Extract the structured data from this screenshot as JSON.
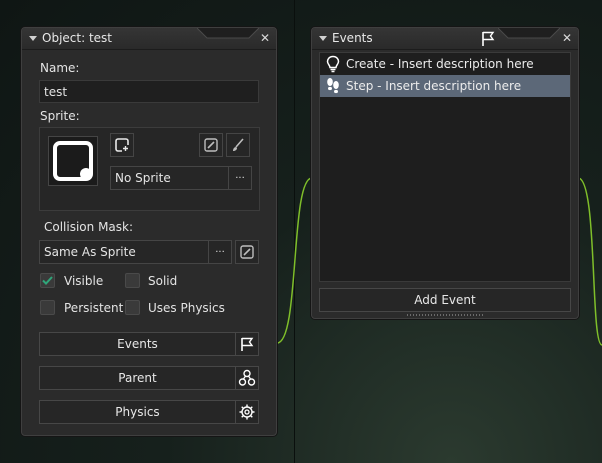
{
  "object_panel": {
    "title": "Object: test",
    "close_glyph": "✕",
    "name_label": "Name:",
    "name_value": "test",
    "sprite_label": "Sprite:",
    "sprite_value": "No Sprite",
    "sprite_menu_glyph": "···",
    "collision_label": "Collision Mask:",
    "collision_value": "Same As Sprite",
    "collision_menu_glyph": "···",
    "checkboxes": [
      {
        "label": "Visible",
        "checked": true
      },
      {
        "label": "Solid",
        "checked": false
      },
      {
        "label": "Persistent",
        "checked": false
      },
      {
        "label": "Uses Physics",
        "checked": false
      }
    ],
    "buttons": [
      {
        "label": "Events",
        "icon": "flag-icon"
      },
      {
        "label": "Parent",
        "icon": "hierarchy-icon"
      },
      {
        "label": "Physics",
        "icon": "gear-icon"
      }
    ]
  },
  "events_panel": {
    "title": "Events",
    "close_glyph": "✕",
    "events": [
      {
        "label": "Create - Insert description here",
        "icon": "lightbulb-icon",
        "selected": false
      },
      {
        "label": "Step - Insert description here",
        "icon": "footsteps-icon",
        "selected": true
      }
    ],
    "add_button": "Add Event"
  },
  "colors": {
    "panel_bg": "#2b2b2b",
    "selection": "#5c6878",
    "check_accent": "#2fa67a",
    "connector": "#7fbf2a"
  }
}
